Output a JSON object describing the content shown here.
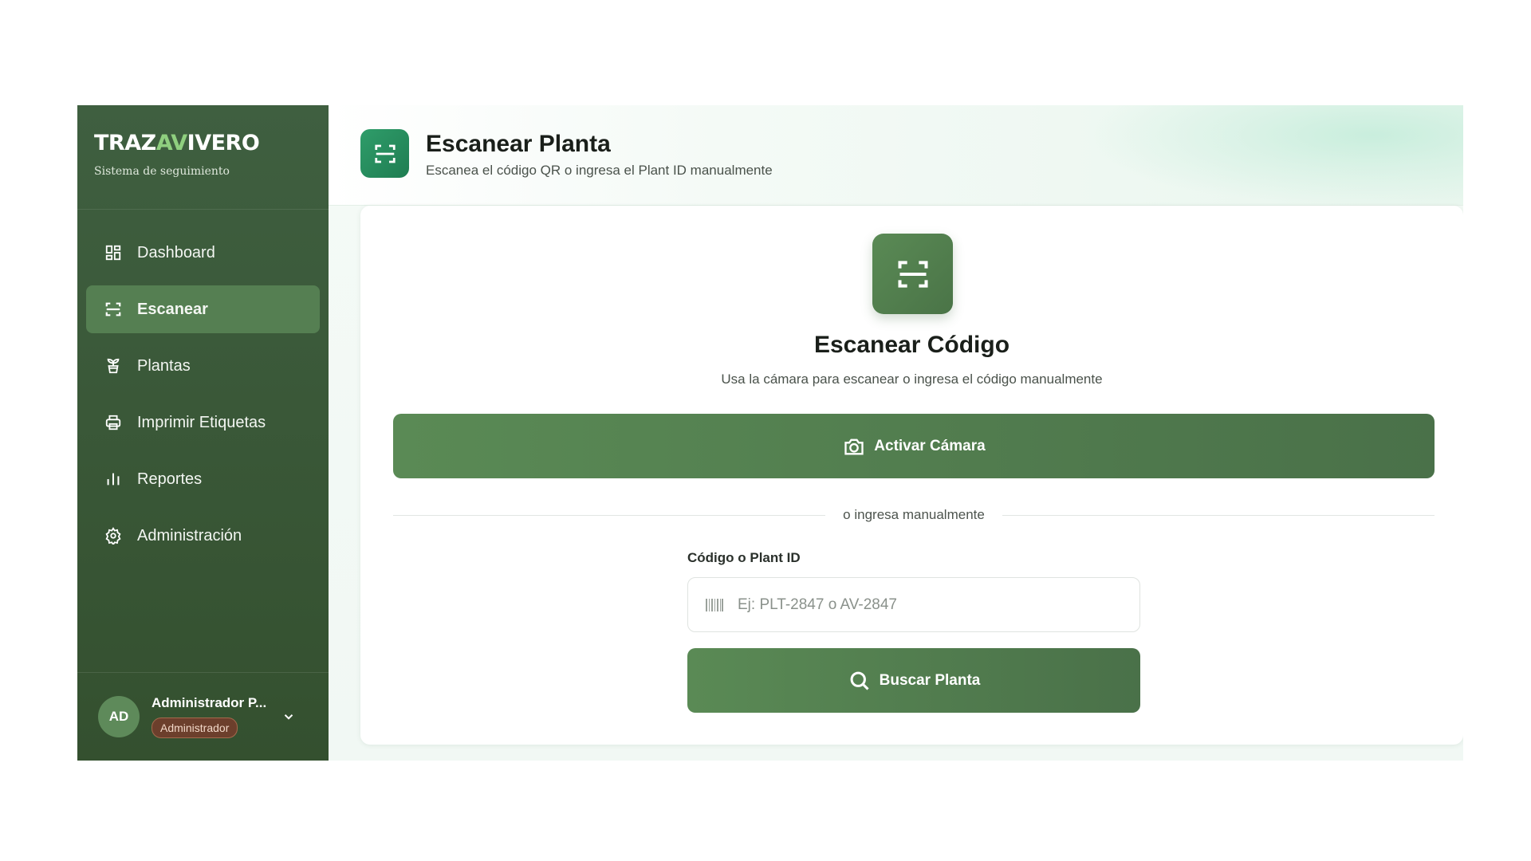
{
  "brand": {
    "title_part1": "TRAZ",
    "title_accent": "AV",
    "title_part2": "IVERO",
    "subtitle": "Sistema de seguimiento"
  },
  "sidebar": {
    "items": [
      {
        "label": "Dashboard",
        "icon": "dashboard-icon",
        "active": false
      },
      {
        "label": "Escanear",
        "icon": "scan-icon",
        "active": true
      },
      {
        "label": "Plantas",
        "icon": "plant-icon",
        "active": false
      },
      {
        "label": "Imprimir Etiquetas",
        "icon": "printer-icon",
        "active": false
      },
      {
        "label": "Reportes",
        "icon": "bar-chart-icon",
        "active": false
      },
      {
        "label": "Administración",
        "icon": "gear-icon",
        "active": false
      }
    ]
  },
  "user": {
    "initials": "AD",
    "name": "Administrador P...",
    "role": "Administrador"
  },
  "header": {
    "title": "Escanear Planta",
    "subtitle": "Escanea el código QR o ingresa el Plant ID manualmente"
  },
  "card": {
    "title": "Escanear Código",
    "subtitle": "Usa la cámara para escanear o ingresa el código manualmente",
    "camera_button": "Activar Cámara",
    "divider_text": "o ingresa manualmente",
    "field_label": "Código o Plant ID",
    "field_placeholder": "Ej: PLT-2847 o AV-2847",
    "field_value": "",
    "search_button": "Buscar Planta"
  },
  "colors": {
    "sidebar": "#3f5f40",
    "active_item": "#557f52",
    "primary": "#5a8a55",
    "header_icon": "#2f9d6a",
    "badge": "#6c3f2c"
  }
}
